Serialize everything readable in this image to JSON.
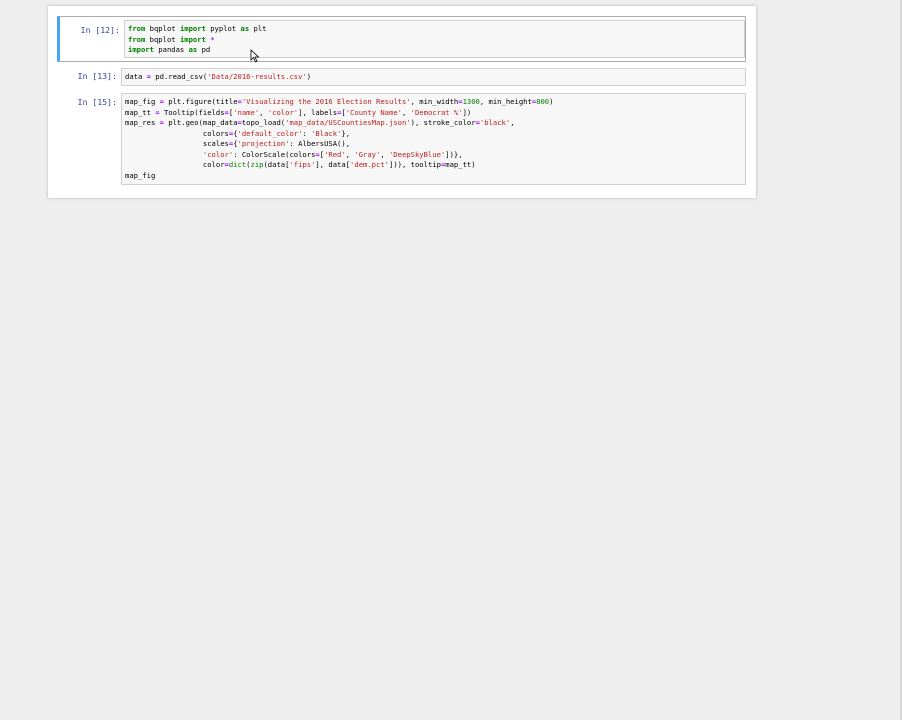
{
  "cells": [
    {
      "prompt": "In [12]:",
      "lines": [
        [
          {
            "t": "from",
            "c": "kw"
          },
          {
            "t": " bqplot ",
            "c": ""
          },
          {
            "t": "import",
            "c": "kw"
          },
          {
            "t": " pyplot ",
            "c": ""
          },
          {
            "t": "as",
            "c": "kw"
          },
          {
            "t": " plt",
            "c": ""
          }
        ],
        [
          {
            "t": "from",
            "c": "kw"
          },
          {
            "t": " bqplot ",
            "c": ""
          },
          {
            "t": "import",
            "c": "kw"
          },
          {
            "t": " ",
            "c": ""
          },
          {
            "t": "*",
            "c": "op"
          }
        ],
        [
          {
            "t": "import",
            "c": "kw"
          },
          {
            "t": " pandas ",
            "c": ""
          },
          {
            "t": "as",
            "c": "kw"
          },
          {
            "t": " pd",
            "c": ""
          }
        ]
      ]
    },
    {
      "prompt": "In [13]:",
      "lines": [
        [
          {
            "t": "data ",
            "c": ""
          },
          {
            "t": "=",
            "c": "op"
          },
          {
            "t": " pd.read_csv(",
            "c": ""
          },
          {
            "t": "'Data/2016-results.csv'",
            "c": "str"
          },
          {
            "t": ")",
            "c": ""
          }
        ]
      ]
    },
    {
      "prompt": "In [15]:",
      "lines": [
        [
          {
            "t": "map_fig ",
            "c": ""
          },
          {
            "t": "=",
            "c": "op"
          },
          {
            "t": " plt.figure(title",
            "c": ""
          },
          {
            "t": "=",
            "c": "op"
          },
          {
            "t": "'Visualizing the 2016 Election Results'",
            "c": "str"
          },
          {
            "t": ", min_width",
            "c": ""
          },
          {
            "t": "=",
            "c": "op"
          },
          {
            "t": "1300",
            "c": "num"
          },
          {
            "t": ", min_height",
            "c": ""
          },
          {
            "t": "=",
            "c": "op"
          },
          {
            "t": "800",
            "c": "num"
          },
          {
            "t": ")",
            "c": ""
          }
        ],
        [
          {
            "t": "map_tt ",
            "c": ""
          },
          {
            "t": "=",
            "c": "op"
          },
          {
            "t": " Tooltip(fields",
            "c": ""
          },
          {
            "t": "=",
            "c": "op"
          },
          {
            "t": "[",
            "c": ""
          },
          {
            "t": "'name'",
            "c": "str"
          },
          {
            "t": ", ",
            "c": ""
          },
          {
            "t": "'color'",
            "c": "str"
          },
          {
            "t": "], labels",
            "c": ""
          },
          {
            "t": "=",
            "c": "op"
          },
          {
            "t": "[",
            "c": ""
          },
          {
            "t": "'County Name'",
            "c": "str"
          },
          {
            "t": ", ",
            "c": ""
          },
          {
            "t": "'Democrat %'",
            "c": "str"
          },
          {
            "t": "])",
            "c": ""
          }
        ],
        [
          {
            "t": "map_res ",
            "c": ""
          },
          {
            "t": "=",
            "c": "op"
          },
          {
            "t": " plt.geo(map_data",
            "c": ""
          },
          {
            "t": "=",
            "c": "op"
          },
          {
            "t": "topo_load(",
            "c": ""
          },
          {
            "t": "'map_data/USCountiesMap.json'",
            "c": "str"
          },
          {
            "t": "), stroke_color",
            "c": ""
          },
          {
            "t": "=",
            "c": "op"
          },
          {
            "t": "'black'",
            "c": "str"
          },
          {
            "t": ",",
            "c": ""
          }
        ],
        [
          {
            "t": "                  colors",
            "c": ""
          },
          {
            "t": "=",
            "c": "op"
          },
          {
            "t": "{",
            "c": ""
          },
          {
            "t": "'default_color'",
            "c": "str"
          },
          {
            "t": ": ",
            "c": ""
          },
          {
            "t": "'Black'",
            "c": "str"
          },
          {
            "t": "},",
            "c": ""
          }
        ],
        [
          {
            "t": "                  scales",
            "c": ""
          },
          {
            "t": "=",
            "c": "op"
          },
          {
            "t": "{",
            "c": ""
          },
          {
            "t": "'projection'",
            "c": "str"
          },
          {
            "t": ": AlbersUSA(),",
            "c": ""
          }
        ],
        [
          {
            "t": "                  ",
            "c": ""
          },
          {
            "t": "'color'",
            "c": "str"
          },
          {
            "t": ": ColorScale(colors",
            "c": ""
          },
          {
            "t": "=",
            "c": "op"
          },
          {
            "t": "[",
            "c": ""
          },
          {
            "t": "'Red'",
            "c": "str"
          },
          {
            "t": ", ",
            "c": ""
          },
          {
            "t": "'Gray'",
            "c": "str"
          },
          {
            "t": ", ",
            "c": ""
          },
          {
            "t": "'DeepSkyBlue'",
            "c": "str"
          },
          {
            "t": "])},",
            "c": ""
          }
        ],
        [
          {
            "t": "                  color",
            "c": ""
          },
          {
            "t": "=",
            "c": "op"
          },
          {
            "t": "dict",
            "c": "bi"
          },
          {
            "t": "(",
            "c": ""
          },
          {
            "t": "zip",
            "c": "bi"
          },
          {
            "t": "(data[",
            "c": ""
          },
          {
            "t": "'fips'",
            "c": "str"
          },
          {
            "t": "], data[",
            "c": ""
          },
          {
            "t": "'dem.pct'",
            "c": "str"
          },
          {
            "t": "])), tooltip",
            "c": ""
          },
          {
            "t": "=",
            "c": "op"
          },
          {
            "t": "map_tt)",
            "c": ""
          }
        ],
        [
          {
            "t": "map_fig",
            "c": ""
          }
        ]
      ]
    }
  ],
  "colors": {
    "selected_border": "#42a5f5",
    "prompt": "#303f9f",
    "keyword": "#008000",
    "string": "#ba2121"
  }
}
